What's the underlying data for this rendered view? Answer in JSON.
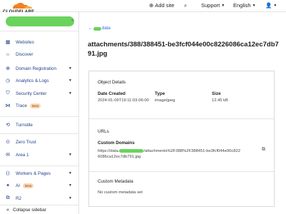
{
  "brand": {
    "logo_text": "CLOUDFLARE",
    "accent": "#f38020"
  },
  "topbar": {
    "add_site": "Add site",
    "support": "Support",
    "language": "English"
  },
  "sidebar": {
    "items": [
      {
        "label": "Websites",
        "icon": "globe-icon"
      },
      {
        "label": "Discover",
        "icon": "lightbulb-icon"
      },
      {
        "label": "Domain Registration",
        "icon": "globe-icon"
      },
      {
        "label": "Analytics & Logs",
        "icon": "clock-icon"
      },
      {
        "label": "Security Center",
        "icon": "shield-icon"
      },
      {
        "label": "Trace",
        "icon": "trace-icon",
        "badge": "Beta"
      },
      {
        "label": "Turnstile",
        "icon": "turnstile-icon"
      },
      {
        "label": "Zero Trust",
        "icon": "lock-icon"
      },
      {
        "label": "Area 1",
        "icon": "mail-icon"
      },
      {
        "label": "Workers & Pages",
        "icon": "workers-icon"
      },
      {
        "label": "AI",
        "icon": "ai-icon",
        "badge": "Beta"
      },
      {
        "label": "R2",
        "icon": "r2-icon"
      }
    ],
    "collapse_label": "Collapse sidebar"
  },
  "main": {
    "back_link_prefix": "←",
    "back_link_suffix": "data",
    "title": "attachments/388/388451-be3fcf044e00c8226086ca12ec7db791.jpg",
    "object_details": {
      "heading": "Object Details",
      "date_label": "Date Created",
      "date_value": "2024-01-09T19:11:03-06:00",
      "type_label": "Type",
      "type_value": "image/jpeg",
      "size_label": "Size",
      "size_value": "12.45 kB"
    },
    "urls": {
      "heading": "URLs",
      "custom_domains_label": "Custom Domains",
      "url_prefix": "https://data.",
      "url_suffix": "/attachments%2F388%2F388451-be3fcf044e00c8226086ca12ec7db791.jpg"
    },
    "metadata": {
      "heading": "Custom Metadata",
      "empty_text": "No custom metadata set"
    }
  }
}
